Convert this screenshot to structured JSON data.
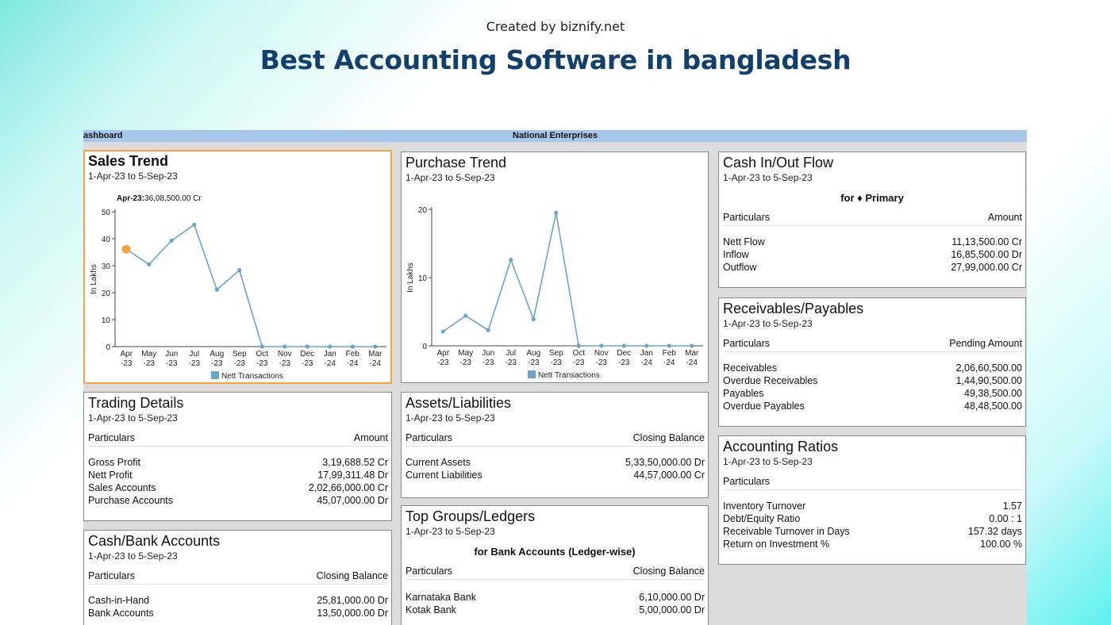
{
  "banner": {
    "credit": "Created by biznify.net",
    "title": "Best Accounting Software in bangladesh"
  },
  "window": {
    "left_title": "ashboard",
    "company": "National Enterprises"
  },
  "colors": {
    "series": "#6aa5c9",
    "highlight": "#f4a340",
    "titlebar": "#a7c7ea",
    "banner_title": "#123f6b"
  },
  "sales_trend": {
    "title": "Sales Trend",
    "period": "1-Apr-23 to 5-Sep-23",
    "tooltip_label": "Apr-23:",
    "tooltip_value": "36,08,500.00 Cr",
    "y_label": "In Lakhs",
    "legend": "Nett Transactions"
  },
  "purchase_trend": {
    "title": "Purchase Trend",
    "period": "1-Apr-23 to 5-Sep-23",
    "y_label": "In Lakhs",
    "legend": "Nett Transactions"
  },
  "chart_data": [
    {
      "type": "line",
      "title": "Sales Trend",
      "ylabel": "In Lakhs",
      "categories": [
        "Apr -23",
        "May -23",
        "Jun -23",
        "Jul -23",
        "Aug -23",
        "Sep -23",
        "Oct -23",
        "Nov -23",
        "Dec -23",
        "Jan -24",
        "Feb -24",
        "Mar -24"
      ],
      "ylim": [
        0,
        50
      ],
      "yticks": [
        0,
        10,
        20,
        30,
        40,
        50
      ],
      "series": [
        {
          "name": "Nett Transactions",
          "values": [
            36.1,
            30.5,
            39.3,
            45.2,
            21.1,
            28.3,
            0,
            0,
            0,
            0,
            0,
            0
          ]
        }
      ],
      "highlight_index": 0,
      "legend": "bottom"
    },
    {
      "type": "line",
      "title": "Purchase Trend",
      "ylabel": "In Lakhs",
      "categories": [
        "Apr -23",
        "May -23",
        "Jun -23",
        "Jul -23",
        "Aug -23",
        "Sep -23",
        "Oct -23",
        "Nov -23",
        "Dec -23",
        "Jan -24",
        "Feb -24",
        "Mar -24"
      ],
      "ylim": [
        0,
        20
      ],
      "yticks": [
        0,
        10,
        20
      ],
      "series": [
        {
          "name": "Nett Transactions",
          "values": [
            2.1,
            4.4,
            2.3,
            12.6,
            3.9,
            19.5,
            0,
            0,
            0,
            0,
            0,
            0
          ]
        }
      ],
      "legend": "bottom"
    }
  ],
  "cash_flow": {
    "title": "Cash In/Out Flow",
    "period": "1-Apr-23 to 5-Sep-23",
    "subhead": "for ♦ Primary",
    "col_left": "Particulars",
    "col_right": "Amount",
    "rows": [
      {
        "label": "Nett Flow",
        "value": "11,13,500.00 Cr"
      },
      {
        "label": "Inflow",
        "value": "16,85,500.00 Dr"
      },
      {
        "label": "Outflow",
        "value": "27,99,000.00 Cr"
      }
    ]
  },
  "receivables": {
    "title": "Receivables/Payables",
    "period": "1-Apr-23 to 5-Sep-23",
    "col_left": "Particulars",
    "col_right": "Pending Amount",
    "rows": [
      {
        "label": "Receivables",
        "value": "2,06,60,500.00"
      },
      {
        "label": "Overdue Receivables",
        "value": "1,44,90,500.00"
      },
      {
        "label": "Payables",
        "value": "49,38,500.00"
      },
      {
        "label": "Overdue Payables",
        "value": "48,48,500.00"
      }
    ]
  },
  "trading": {
    "title": "Trading Details",
    "period": "1-Apr-23 to 5-Sep-23",
    "col_left": "Particulars",
    "col_right": "Amount",
    "rows": [
      {
        "label": "Gross Profit",
        "value": "3,19,688.52 Cr"
      },
      {
        "label": "Nett Profit",
        "value": "17,99,311.48 Dr"
      },
      {
        "label": "Sales Accounts",
        "value": "2,02,66,000.00 Cr"
      },
      {
        "label": "Purchase Accounts",
        "value": "45,07,000.00 Dr"
      }
    ]
  },
  "assets": {
    "title": "Assets/Liabilities",
    "period": "1-Apr-23 to 5-Sep-23",
    "col_left": "Particulars",
    "col_right": "Closing Balance",
    "rows": [
      {
        "label": "Current Assets",
        "value": "5,33,50,000.00 Dr"
      },
      {
        "label": "Current Liabilities",
        "value": "44,57,000.00 Cr"
      }
    ]
  },
  "ratios": {
    "title": "Accounting Ratios",
    "period": "1-Apr-23 to 5-Sep-23",
    "col_left": "Particulars",
    "rows": [
      {
        "label": "Inventory Turnover",
        "value": "1.57"
      },
      {
        "label": "Debt/Equity Ratio",
        "value": "0.00 : 1"
      },
      {
        "label": "Receivable Turnover in Days",
        "value": "157.32 days"
      },
      {
        "label": "Return on Investment %",
        "value": "100.00 %"
      }
    ]
  },
  "cashbank": {
    "title": "Cash/Bank Accounts",
    "period": "1-Apr-23 to 5-Sep-23",
    "col_left": "Particulars",
    "col_right": "Closing Balance",
    "rows": [
      {
        "label": "Cash-in-Hand",
        "value": "25,81,000.00 Dr"
      },
      {
        "label": "Bank Accounts",
        "value": "13,50,000.00 Dr"
      }
    ]
  },
  "topgroups": {
    "title": "Top Groups/Ledgers",
    "period": "1-Apr-23 to 5-Sep-23",
    "subhead": "for Bank Accounts (Ledger-wise)",
    "col_left": "Particulars",
    "col_right": "Closing Balance",
    "rows": [
      {
        "label": "Karnataka Bank",
        "value": "6,10,000.00 Dr"
      },
      {
        "label": "Kotak Bank",
        "value": "5,00,000.00 Dr"
      }
    ]
  }
}
